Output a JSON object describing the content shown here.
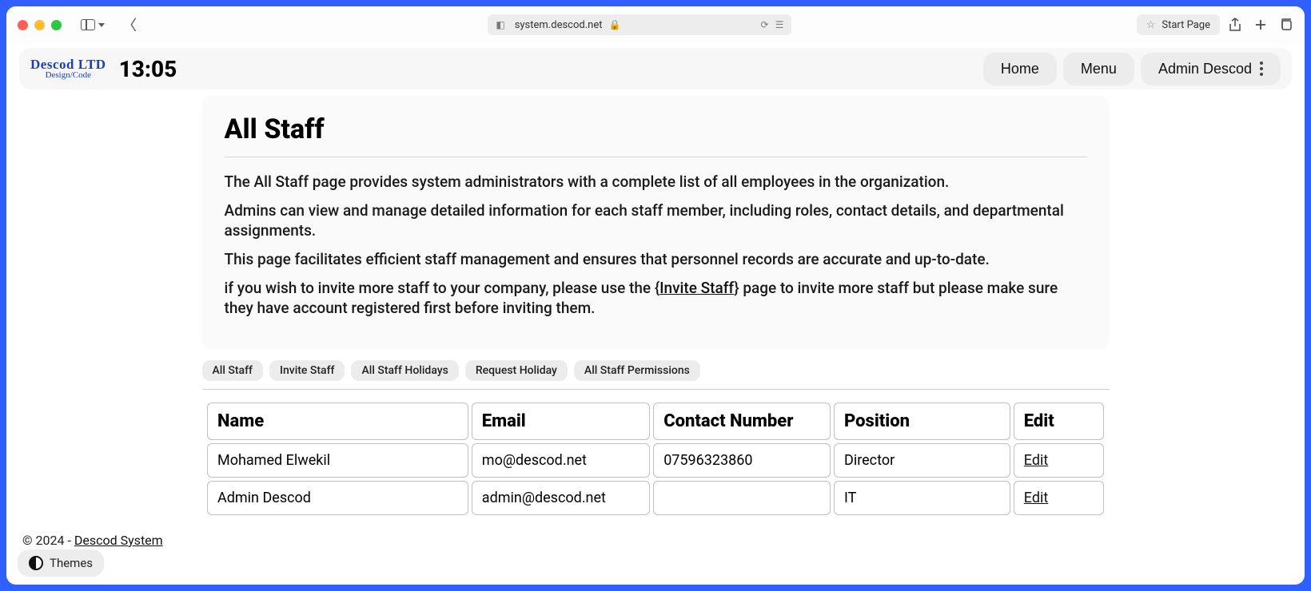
{
  "browser": {
    "url": "system.descod.net",
    "start_page_label": "Start Page"
  },
  "header": {
    "logo_top": "Descod LTD",
    "logo_sub": "Design/Code",
    "time": "13:05",
    "nav": {
      "home": "Home",
      "menu": "Menu",
      "user": "Admin Descod"
    }
  },
  "page": {
    "title": "All Staff",
    "p1": "The All Staff page provides system administrators with a complete list of all employees in the organization.",
    "p2": "Admins can view and manage detailed information for each staff member, including roles, contact details, and departmental assignments.",
    "p3": "This page facilitates efficient staff management and ensures that personnel records are accurate and up-to-date.",
    "p4_pre": "if you wish to invite more staff to your company, please use the {",
    "p4_link": "Invite Staff",
    "p4_post": "} page to invite more staff but please make sure they have account registered first before inviting them."
  },
  "tabs": [
    "All Staff",
    "Invite Staff",
    "All Staff Holidays",
    "Request Holiday",
    "All Staff Permissions"
  ],
  "table": {
    "columns": [
      "Name",
      "Email",
      "Contact Number",
      "Position",
      "Edit"
    ],
    "rows": [
      {
        "name": "Mohamed Elwekil",
        "email": "mo@descod.net",
        "contact": "07596323860",
        "position": "Director",
        "edit": "Edit"
      },
      {
        "name": "Admin Descod",
        "email": "admin@descod.net",
        "contact": "",
        "position": "IT",
        "edit": "Edit"
      }
    ]
  },
  "footer": {
    "prefix": "© 2024 - ",
    "link": "Descod System"
  },
  "themes_label": "Themes"
}
